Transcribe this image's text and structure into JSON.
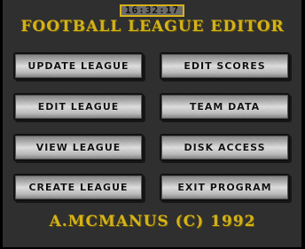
{
  "clock": "16:32:17",
  "title": "FOOTBALL LEAGUE EDITOR",
  "menu": {
    "update_league": "UPDATE LEAGUE",
    "edit_scores": "EDIT SCORES",
    "edit_league": "EDIT LEAGUE",
    "team_data": "TEAM DATA",
    "view_league": "VIEW LEAGUE",
    "disk_access": "DISK ACCESS",
    "create_league": "CREATE LEAGUE",
    "exit_program": "EXIT PROGRAM"
  },
  "footer": "A.MCMANUS (C) 1992",
  "colors": {
    "title_gold": "#d4b21a",
    "background": "#2f2f2f",
    "button_face": "#d0d0d0"
  }
}
